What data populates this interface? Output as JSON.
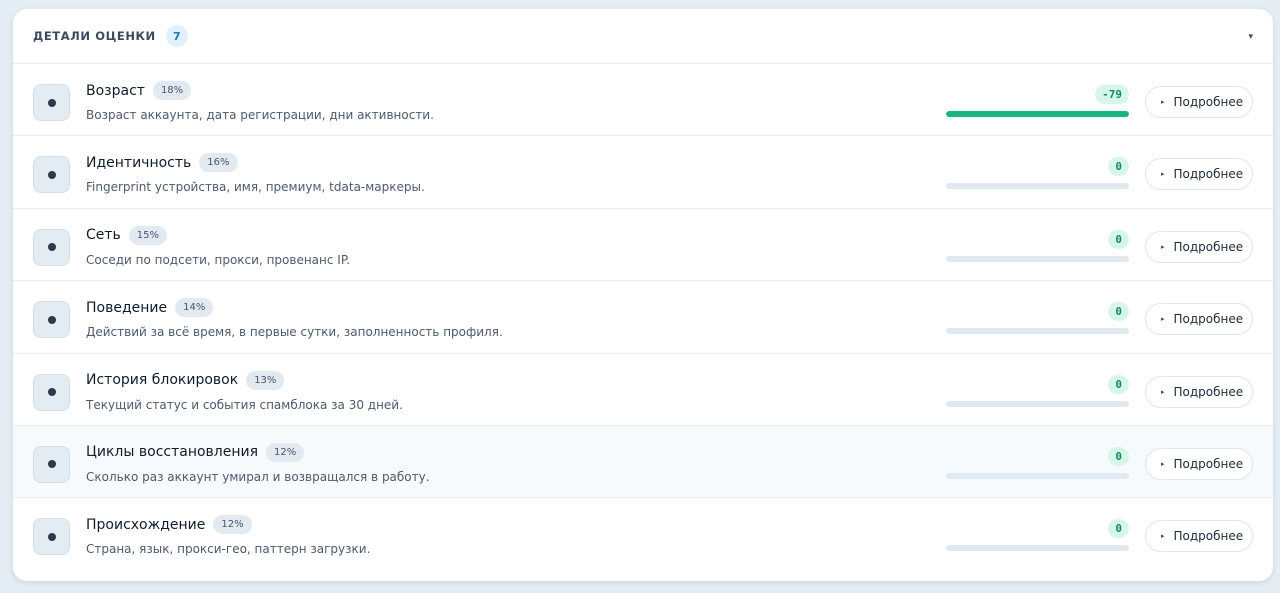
{
  "header": {
    "title": "ДЕТАЛИ ОЦЕНКИ",
    "count": "7",
    "toggle_icon": "▾"
  },
  "more_label": "Подробнее",
  "more_caret": "▸",
  "colors": {
    "accent_green": "#14b87a",
    "badge_blue": "#dff1fb"
  },
  "rows": [
    {
      "title": "Возраст",
      "weight": "18%",
      "desc": "Возраст аккаунта, дата регистрации, дни активности.",
      "score": "-79",
      "progress": 1.0,
      "highlighted": false
    },
    {
      "title": "Идентичность",
      "weight": "16%",
      "desc": "Fingerprint устройства, имя, премиум, tdata-маркеры.",
      "score": "0",
      "progress": 0,
      "highlighted": false
    },
    {
      "title": "Сеть",
      "weight": "15%",
      "desc": "Соседи по подсети, прокси, провенанс IP.",
      "score": "0",
      "progress": 0,
      "highlighted": false
    },
    {
      "title": "Поведение",
      "weight": "14%",
      "desc": "Действий за всё время, в первые сутки, заполненность профиля.",
      "score": "0",
      "progress": 0,
      "highlighted": false
    },
    {
      "title": "История блокировок",
      "weight": "13%",
      "desc": "Текущий статус и события спамблока за 30 дней.",
      "score": "0",
      "progress": 0,
      "highlighted": false
    },
    {
      "title": "Циклы восстановления",
      "weight": "12%",
      "desc": "Сколько раз аккаунт умирал и возвращался в работу.",
      "score": "0",
      "progress": 0,
      "highlighted": true
    },
    {
      "title": "Происхождение",
      "weight": "12%",
      "desc": "Страна, язык, прокси-гео, паттерн загрузки.",
      "score": "0",
      "progress": 0,
      "highlighted": false
    }
  ]
}
